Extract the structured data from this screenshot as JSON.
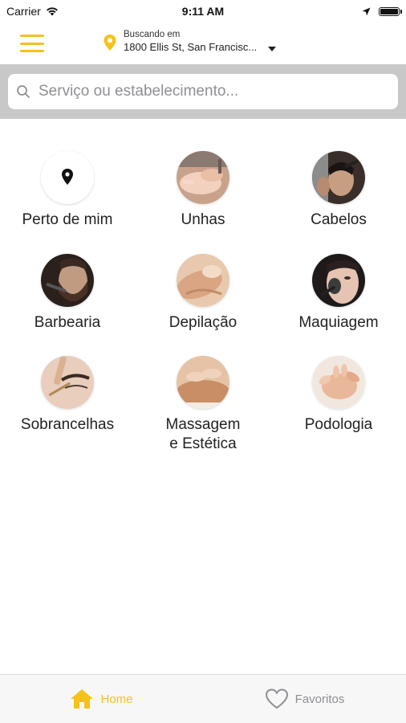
{
  "status_bar": {
    "carrier": "Carrier",
    "time": "9:11 AM"
  },
  "header": {
    "location_label": "Buscando em",
    "location_address": "1800 Ellis St, San Francisc..."
  },
  "search": {
    "placeholder": "Serviço ou estabelecimento..."
  },
  "categories": [
    {
      "label": "Perto de mim",
      "icon": "location-pin-icon"
    },
    {
      "label": "Unhas",
      "icon": "nails-photo"
    },
    {
      "label": "Cabelos",
      "icon": "haircut-photo"
    },
    {
      "label": "Barbearia",
      "icon": "barber-photo"
    },
    {
      "label": "Depilação",
      "icon": "waxing-photo"
    },
    {
      "label": "Maquiagem",
      "icon": "makeup-photo"
    },
    {
      "label": "Sobrancelhas",
      "icon": "eyebrows-photo"
    },
    {
      "label": "Massagem\ne Estética",
      "icon": "massage-photo"
    },
    {
      "label": "Podologia",
      "icon": "podology-photo"
    }
  ],
  "tab_bar": {
    "home_label": "Home",
    "favorites_label": "Favoritos"
  },
  "colors": {
    "accent": "#f5c21b",
    "search_band": "#c8c8c8",
    "inactive_tab": "#8e8e93"
  }
}
